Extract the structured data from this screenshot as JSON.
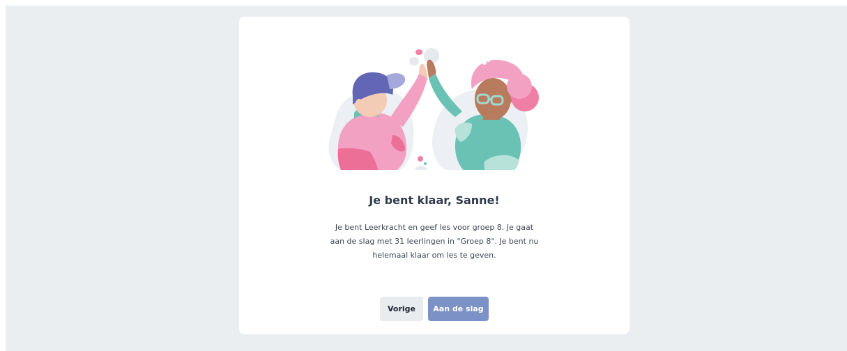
{
  "dialog": {
    "title": "Je bent klaar, Sanne!",
    "message": "Je bent Leerkracht en geef les voor groep 8. Je gaat aan de slag met 31 leerlingen in \"Groep 8\". Je bent nu helemaal klaar om les te geven.",
    "back_label": "Vorige",
    "start_label": "Aan de slag"
  },
  "illustration": {
    "name": "high-five-illustration"
  },
  "colors": {
    "background": "#ebeef1",
    "card": "#ffffff",
    "primary_button": "#7c91c6",
    "secondary_button": "#e9ecef",
    "title_text": "#2f3a4a"
  }
}
